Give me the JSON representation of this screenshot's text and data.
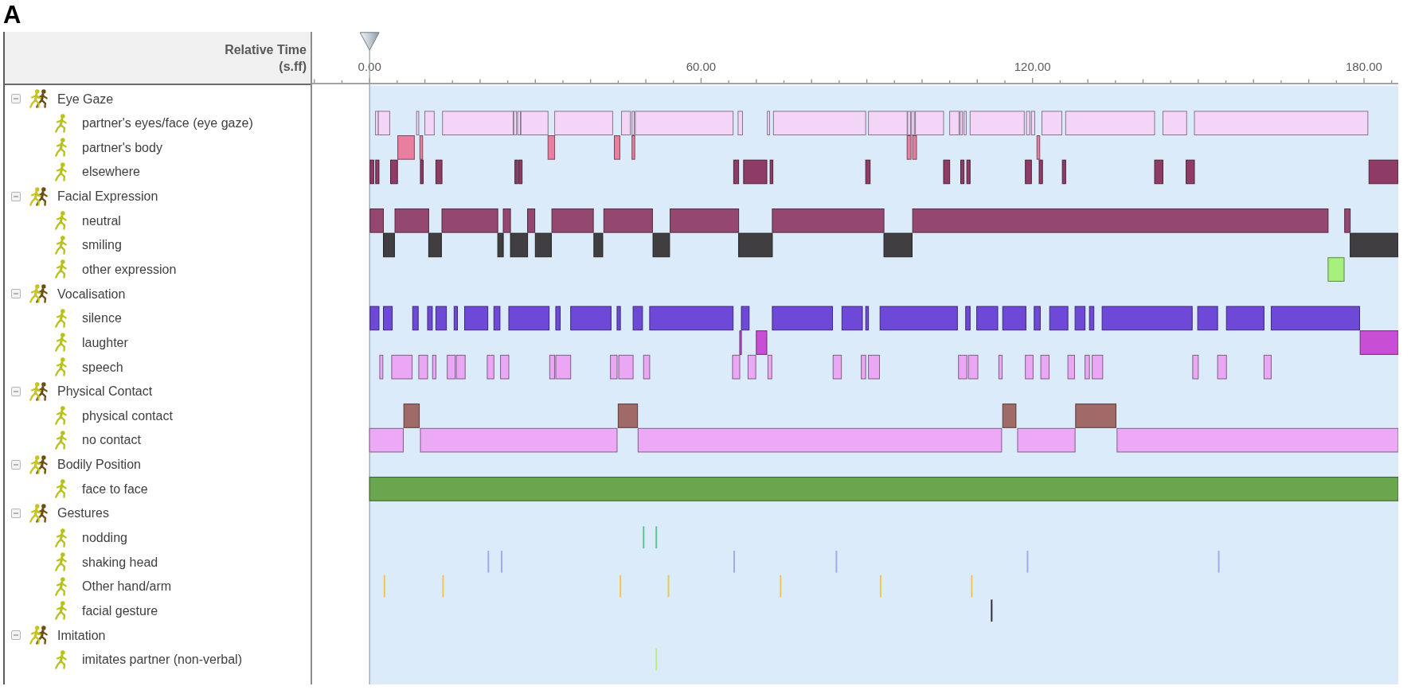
{
  "panel_label": "A",
  "header": {
    "title": "Relative Time",
    "unit": "(s.ff)"
  },
  "ruler": {
    "labels": [
      "0.00",
      "60.00",
      "120.00",
      "180.00"
    ]
  },
  "tree": [
    {
      "label": "Eye Gaze",
      "expanded": true,
      "children": [
        {
          "label": "partner's eyes/face (eye gaze)",
          "color": "#f3d5f8"
        },
        {
          "label": "partner's body",
          "color": "#e6809e"
        },
        {
          "label": "elsewhere",
          "color": "#8e3c66"
        }
      ]
    },
    {
      "label": "Facial Expression",
      "expanded": true,
      "children": [
        {
          "label": "neutral",
          "color": "#944870"
        },
        {
          "label": "smiling",
          "color": "#403e40"
        },
        {
          "label": "other expression",
          "color": "#a8f07e"
        }
      ]
    },
    {
      "label": "Vocalisation",
      "expanded": true,
      "children": [
        {
          "label": "silence",
          "color": "#6e48d6"
        },
        {
          "label": "laughter",
          "color": "#c84ed6"
        },
        {
          "label": "speech",
          "color": "#eaa8f4"
        }
      ]
    },
    {
      "label": "Physical Contact",
      "expanded": true,
      "children": [
        {
          "label": "physical contact",
          "color": "#a06a68"
        },
        {
          "label": "no contact",
          "color": "#ecaaf6"
        }
      ]
    },
    {
      "label": "Bodily Position",
      "expanded": true,
      "children": [
        {
          "label": "face to face",
          "color": "#6aa64e"
        }
      ]
    },
    {
      "label": "Gestures",
      "expanded": true,
      "children": [
        {
          "label": "nodding",
          "color": "#5cc496"
        },
        {
          "label": "shaking head",
          "color": "#a4a8ee"
        },
        {
          "label": "Other hand/arm",
          "color": "#f2c64c"
        },
        {
          "label": "facial gesture",
          "color": "#30303a"
        }
      ]
    },
    {
      "label": "Imitation",
      "expanded": true,
      "children": [
        {
          "label": "imitates partner (non-verbal)",
          "color": "#b8f07c"
        }
      ]
    }
  ]
}
